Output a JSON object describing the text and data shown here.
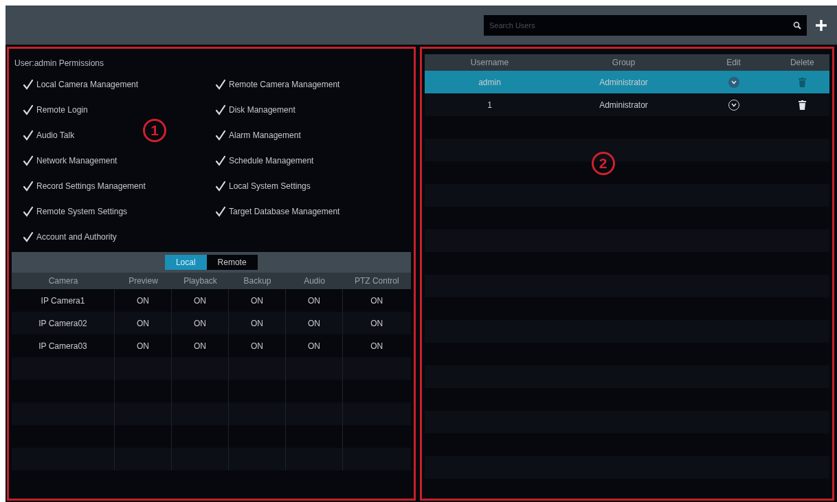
{
  "search": {
    "placeholder": "Search Users"
  },
  "permissions_panel": {
    "title": "User:admin Permissions",
    "annotation": "1",
    "permissions": [
      {
        "label": "Local Camera Management",
        "checked": true
      },
      {
        "label": "Remote Camera Management",
        "checked": true
      },
      {
        "label": "Remote Login",
        "checked": true
      },
      {
        "label": "Disk Management",
        "checked": true
      },
      {
        "label": "Audio Talk",
        "checked": true
      },
      {
        "label": "Alarm Management",
        "checked": true
      },
      {
        "label": "Network Management",
        "checked": true
      },
      {
        "label": "Schedule Management",
        "checked": true
      },
      {
        "label": "Record Settings Management",
        "checked": true
      },
      {
        "label": "Local System Settings",
        "checked": true
      },
      {
        "label": "Remote System Settings",
        "checked": true
      },
      {
        "label": "Target Database Management",
        "checked": true
      },
      {
        "label": "Account and Authority",
        "checked": true
      }
    ],
    "tabs": [
      {
        "label": "Local",
        "selected": true
      },
      {
        "label": "Remote",
        "selected": false
      }
    ],
    "table": {
      "columns": [
        "Camera",
        "Preview",
        "Playback",
        "Backup",
        "Audio",
        "PTZ Control"
      ],
      "rows": [
        [
          "IP Camera1",
          "ON",
          "ON",
          "ON",
          "ON",
          "ON"
        ],
        [
          "IP Camera02",
          "ON",
          "ON",
          "ON",
          "ON",
          "ON"
        ],
        [
          "IP Camera03",
          "ON",
          "ON",
          "ON",
          "ON",
          "ON"
        ]
      ]
    }
  },
  "users_panel": {
    "annotation": "2",
    "table": {
      "columns": [
        "Username",
        "Group",
        "Edit",
        "Delete"
      ],
      "rows": [
        {
          "username": "admin",
          "group": "Administrator",
          "selected": true
        },
        {
          "username": "1",
          "group": "Administrator",
          "selected": false
        }
      ]
    }
  }
}
